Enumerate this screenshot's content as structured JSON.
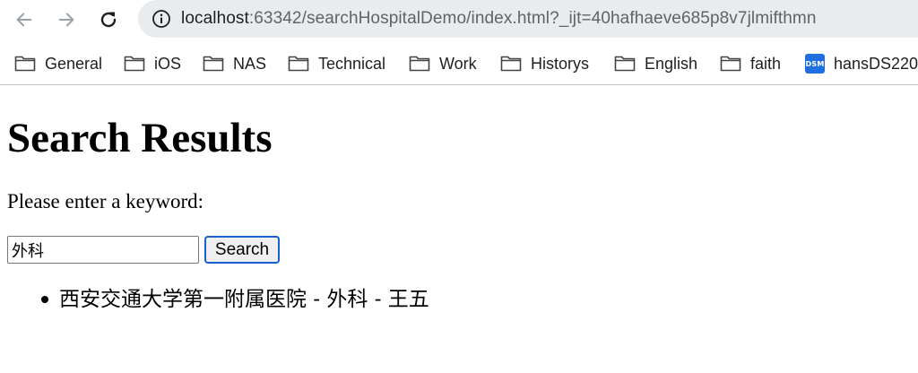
{
  "browser": {
    "url_host": "localhost",
    "url_rest": ":63342/searchHospitalDemo/index.html?_ijt=40hafhaeve685p8v7jlmifthmn"
  },
  "bookmarks": [
    {
      "label": "General",
      "icon": "folder-icon"
    },
    {
      "label": "iOS",
      "icon": "folder-icon"
    },
    {
      "label": "NAS",
      "icon": "folder-icon"
    },
    {
      "label": "Technical",
      "icon": "folder-icon"
    },
    {
      "label": "Work",
      "icon": "folder-icon"
    },
    {
      "label": "Historys",
      "icon": "folder-icon"
    },
    {
      "label": "English",
      "icon": "folder-icon"
    },
    {
      "label": "faith",
      "icon": "folder-icon"
    },
    {
      "label": "hansDS220",
      "icon": "dsm-icon",
      "badge": "DSM"
    }
  ],
  "page": {
    "title": "Search Results",
    "prompt": "Please enter a keyword:",
    "search_value": "外科",
    "search_button": "Search",
    "results": [
      "西安交通大学第一附属医院 - 外科 - 王五"
    ]
  },
  "colors": {
    "omnibox_bg": "#e9ecef",
    "button_focus_border": "#1a5fd0",
    "dsm_badge": "#1f6fe0"
  }
}
